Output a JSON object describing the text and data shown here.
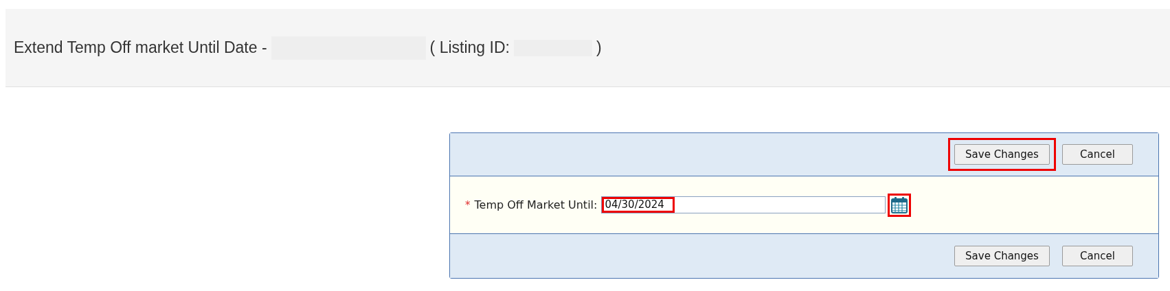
{
  "header": {
    "title": "Extend Temp Off market Until Date -",
    "listing_id_label": "( Listing ID:",
    "closing": ")"
  },
  "form": {
    "top_buttons": [
      {
        "label": "Save Changes",
        "kind": "save",
        "highlighted": true
      },
      {
        "label": "Cancel",
        "kind": "cancel",
        "highlighted": false
      }
    ],
    "field": {
      "required": true,
      "required_mark": "*",
      "label": "Temp Off Market Until:",
      "value": "04/30/2024",
      "value_highlighted": true,
      "calendar_highlighted": true
    },
    "bottom_buttons": [
      {
        "label": "Save Changes",
        "kind": "save",
        "highlighted": false
      },
      {
        "label": "Cancel",
        "kind": "cancel",
        "highlighted": false
      }
    ]
  }
}
